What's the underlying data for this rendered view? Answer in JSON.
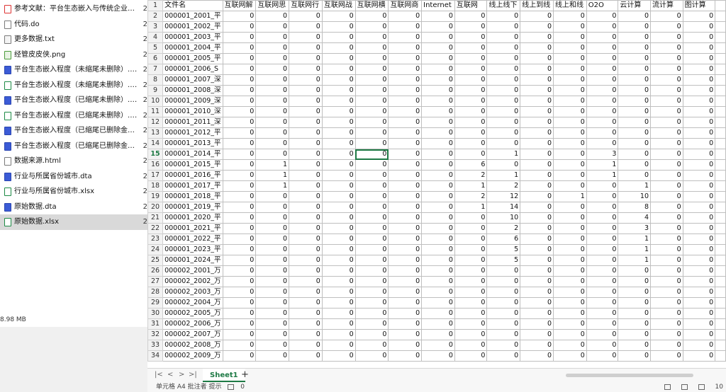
{
  "file_pane": {
    "files": [
      {
        "name": "参考文献：平台生态嵌入与传统企业价值...",
        "icon": "pdf-file-icon",
        "type": "pdf",
        "trail": "2"
      },
      {
        "name": "代码.do",
        "icon": "do-file-icon",
        "type": "do",
        "trail": "2"
      },
      {
        "name": "更多数据.txt",
        "icon": "txt-file-icon",
        "type": "txt",
        "trail": "2"
      },
      {
        "name": "经管皮皮侠.png",
        "icon": "png-file-icon",
        "type": "png",
        "trail": "2"
      },
      {
        "name": "平台生态嵌入程度（未缩尾未删除）.dta",
        "icon": "dta-file-icon",
        "type": "dta",
        "trail": "2"
      },
      {
        "name": "平台生态嵌入程度（未缩尾未删除）.xlsx",
        "icon": "xlsx-file-icon",
        "type": "xlsx",
        "trail": "2"
      },
      {
        "name": "平台生态嵌入程度（已缩尾未删除）.dta",
        "icon": "dta-file-icon",
        "type": "dta",
        "trail": "2"
      },
      {
        "name": "平台生态嵌入程度（已缩尾未删除）.xlsx",
        "icon": "xlsx-file-icon",
        "type": "xlsx",
        "trail": "2"
      },
      {
        "name": "平台生态嵌入程度（已缩尾已删除金融S...",
        "icon": "dta-file-icon",
        "type": "dta",
        "trail": "2"
      },
      {
        "name": "平台生态嵌入程度（已缩尾已删除金融S...",
        "icon": "dta-file-icon",
        "type": "dta",
        "trail": "2"
      },
      {
        "name": "数据来源.html",
        "icon": "html-file-icon",
        "type": "html",
        "trail": "2"
      },
      {
        "name": "行业与所属省份城市.dta",
        "icon": "dta-file-icon",
        "type": "dta",
        "trail": "2"
      },
      {
        "name": "行业与所属省份城市.xlsx",
        "icon": "xlsx-file-icon",
        "type": "xlsx",
        "trail": "2"
      },
      {
        "name": "原始数据.dta",
        "icon": "dta-file-icon",
        "type": "dta",
        "trail": "2"
      },
      {
        "name": "原始数据.xlsx",
        "icon": "xlsx-file-icon",
        "type": "xlsx",
        "trail": "2",
        "selected": true
      }
    ],
    "selection_size": "8.98 MB"
  },
  "sheet": {
    "headers": [
      "文件名",
      "互联网解",
      "互联网思",
      "互联网行",
      "互联网战",
      "互联网横",
      "互联网商",
      "Internet",
      "互联网",
      "线上线下",
      "线上到线",
      "线上和线",
      "O2O",
      "云计算",
      "流计算",
      "图计算",
      ""
    ],
    "rows": [
      {
        "num": "2",
        "cells": [
          "000001_2001_平",
          "0",
          "0",
          "0",
          "0",
          "0",
          "0",
          "0",
          "0",
          "0",
          "0",
          "0",
          "0",
          "0",
          "0",
          "0"
        ]
      },
      {
        "num": "3",
        "cells": [
          "000001_2002_平",
          "0",
          "0",
          "0",
          "0",
          "0",
          "0",
          "0",
          "0",
          "0",
          "0",
          "0",
          "0",
          "0",
          "0",
          "0"
        ]
      },
      {
        "num": "4",
        "cells": [
          "000001_2003_平",
          "0",
          "0",
          "0",
          "0",
          "0",
          "0",
          "0",
          "0",
          "0",
          "0",
          "0",
          "0",
          "0",
          "0",
          "0"
        ]
      },
      {
        "num": "5",
        "cells": [
          "000001_2004_平",
          "0",
          "0",
          "0",
          "0",
          "0",
          "0",
          "0",
          "0",
          "0",
          "0",
          "0",
          "0",
          "0",
          "0",
          "0"
        ]
      },
      {
        "num": "6",
        "cells": [
          "000001_2005_平",
          "0",
          "0",
          "0",
          "0",
          "0",
          "0",
          "0",
          "0",
          "0",
          "0",
          "0",
          "0",
          "0",
          "0",
          "0"
        ]
      },
      {
        "num": "7",
        "cells": [
          "000001_2006_S",
          "0",
          "0",
          "0",
          "0",
          "0",
          "0",
          "0",
          "0",
          "0",
          "0",
          "0",
          "0",
          "0",
          "0",
          "0"
        ]
      },
      {
        "num": "8",
        "cells": [
          "000001_2007_深",
          "0",
          "0",
          "0",
          "0",
          "0",
          "0",
          "0",
          "0",
          "0",
          "0",
          "0",
          "0",
          "0",
          "0",
          "0"
        ]
      },
      {
        "num": "9",
        "cells": [
          "000001_2008_深",
          "0",
          "0",
          "0",
          "0",
          "0",
          "0",
          "0",
          "0",
          "0",
          "0",
          "0",
          "0",
          "0",
          "0",
          "0"
        ]
      },
      {
        "num": "10",
        "cells": [
          "000001_2009_深",
          "0",
          "0",
          "0",
          "0",
          "0",
          "0",
          "0",
          "0",
          "0",
          "0",
          "0",
          "0",
          "0",
          "0",
          "0"
        ]
      },
      {
        "num": "11",
        "cells": [
          "000001_2010_深",
          "0",
          "0",
          "0",
          "0",
          "0",
          "0",
          "0",
          "0",
          "0",
          "0",
          "0",
          "0",
          "0",
          "0",
          "0"
        ]
      },
      {
        "num": "12",
        "cells": [
          "000001_2011_深",
          "0",
          "0",
          "0",
          "0",
          "0",
          "0",
          "0",
          "0",
          "0",
          "0",
          "0",
          "0",
          "0",
          "0",
          "0"
        ]
      },
      {
        "num": "13",
        "cells": [
          "000001_2012_平",
          "0",
          "0",
          "0",
          "0",
          "0",
          "0",
          "0",
          "0",
          "0",
          "0",
          "0",
          "0",
          "0",
          "0",
          "0"
        ]
      },
      {
        "num": "14",
        "cells": [
          "000001_2013_平",
          "0",
          "0",
          "0",
          "0",
          "0",
          "0",
          "0",
          "0",
          "0",
          "0",
          "0",
          "0",
          "0",
          "0",
          "0"
        ]
      },
      {
        "num": "15",
        "cells": [
          "000001_2014_平",
          "0",
          "0",
          "0",
          "0",
          "0",
          "0",
          "0",
          "0",
          "1",
          "0",
          "0",
          "3",
          "0",
          "0",
          "0"
        ]
      },
      {
        "num": "16",
        "cells": [
          "000001_2015_平",
          "0",
          "1",
          "0",
          "0",
          "0",
          "0",
          "0",
          "6",
          "0",
          "0",
          "0",
          "1",
          "0",
          "0",
          "0"
        ]
      },
      {
        "num": "17",
        "cells": [
          "000001_2016_平",
          "0",
          "1",
          "0",
          "0",
          "0",
          "0",
          "0",
          "2",
          "1",
          "0",
          "0",
          "1",
          "0",
          "0",
          "0"
        ]
      },
      {
        "num": "18",
        "cells": [
          "000001_2017_平",
          "0",
          "1",
          "0",
          "0",
          "0",
          "0",
          "0",
          "1",
          "2",
          "0",
          "0",
          "0",
          "1",
          "0",
          "0"
        ]
      },
      {
        "num": "19",
        "cells": [
          "000001_2018_平",
          "0",
          "0",
          "0",
          "0",
          "0",
          "0",
          "0",
          "2",
          "12",
          "0",
          "1",
          "0",
          "10",
          "0",
          "0"
        ]
      },
      {
        "num": "20",
        "cells": [
          "000001_2019_平",
          "0",
          "0",
          "0",
          "0",
          "0",
          "0",
          "0",
          "1",
          "14",
          "0",
          "0",
          "0",
          "8",
          "0",
          "0"
        ]
      },
      {
        "num": "21",
        "cells": [
          "000001_2020_平",
          "0",
          "0",
          "0",
          "0",
          "0",
          "0",
          "0",
          "0",
          "10",
          "0",
          "0",
          "0",
          "4",
          "0",
          "0"
        ]
      },
      {
        "num": "22",
        "cells": [
          "000001_2021_平",
          "0",
          "0",
          "0",
          "0",
          "0",
          "0",
          "0",
          "0",
          "2",
          "0",
          "0",
          "0",
          "3",
          "0",
          "0"
        ]
      },
      {
        "num": "23",
        "cells": [
          "000001_2022_平",
          "0",
          "0",
          "0",
          "0",
          "0",
          "0",
          "0",
          "0",
          "6",
          "0",
          "0",
          "0",
          "1",
          "0",
          "0"
        ]
      },
      {
        "num": "24",
        "cells": [
          "000001_2023_平",
          "0",
          "0",
          "0",
          "0",
          "0",
          "0",
          "0",
          "0",
          "5",
          "0",
          "0",
          "0",
          "1",
          "0",
          "0"
        ]
      },
      {
        "num": "25",
        "cells": [
          "000001_2024_平",
          "0",
          "0",
          "0",
          "0",
          "0",
          "0",
          "0",
          "0",
          "5",
          "0",
          "0",
          "0",
          "1",
          "0",
          "0"
        ]
      },
      {
        "num": "26",
        "cells": [
          "000002_2001_万",
          "0",
          "0",
          "0",
          "0",
          "0",
          "0",
          "0",
          "0",
          "0",
          "0",
          "0",
          "0",
          "0",
          "0",
          "0"
        ]
      },
      {
        "num": "27",
        "cells": [
          "000002_2002_万",
          "0",
          "0",
          "0",
          "0",
          "0",
          "0",
          "0",
          "0",
          "0",
          "0",
          "0",
          "0",
          "0",
          "0",
          "0"
        ]
      },
      {
        "num": "28",
        "cells": [
          "000002_2003_万",
          "0",
          "0",
          "0",
          "0",
          "0",
          "0",
          "0",
          "0",
          "0",
          "0",
          "0",
          "0",
          "0",
          "0",
          "0"
        ]
      },
      {
        "num": "29",
        "cells": [
          "000002_2004_万",
          "0",
          "0",
          "0",
          "0",
          "0",
          "0",
          "0",
          "0",
          "0",
          "0",
          "0",
          "0",
          "0",
          "0",
          "0"
        ]
      },
      {
        "num": "30",
        "cells": [
          "000002_2005_万",
          "0",
          "0",
          "0",
          "0",
          "0",
          "0",
          "0",
          "0",
          "0",
          "0",
          "0",
          "0",
          "0",
          "0",
          "0"
        ]
      },
      {
        "num": "31",
        "cells": [
          "000002_2006_万",
          "0",
          "0",
          "0",
          "0",
          "0",
          "0",
          "0",
          "0",
          "0",
          "0",
          "0",
          "0",
          "0",
          "0",
          "0"
        ]
      },
      {
        "num": "32",
        "cells": [
          "000002_2007_万",
          "0",
          "0",
          "0",
          "0",
          "0",
          "0",
          "0",
          "0",
          "0",
          "0",
          "0",
          "0",
          "0",
          "0",
          "0"
        ]
      },
      {
        "num": "33",
        "cells": [
          "000002_2008_万",
          "0",
          "0",
          "0",
          "0",
          "0",
          "0",
          "0",
          "0",
          "0",
          "0",
          "0",
          "0",
          "0",
          "0",
          "0"
        ]
      },
      {
        "num": "34",
        "cells": [
          "000002_2009_万",
          "0",
          "0",
          "0",
          "0",
          "0",
          "0",
          "0",
          "0",
          "0",
          "0",
          "0",
          "0",
          "0",
          "0",
          "0"
        ]
      }
    ],
    "active_row": "15",
    "active_col": 5
  },
  "tabbar": {
    "nav": [
      "|<",
      "<",
      ">",
      ">|"
    ],
    "sheet_tab": "Sheet1",
    "add_tab": "+"
  },
  "status": {
    "left": "单元格 A4 批注者 提示",
    "count": "0",
    "zoom": "10"
  }
}
